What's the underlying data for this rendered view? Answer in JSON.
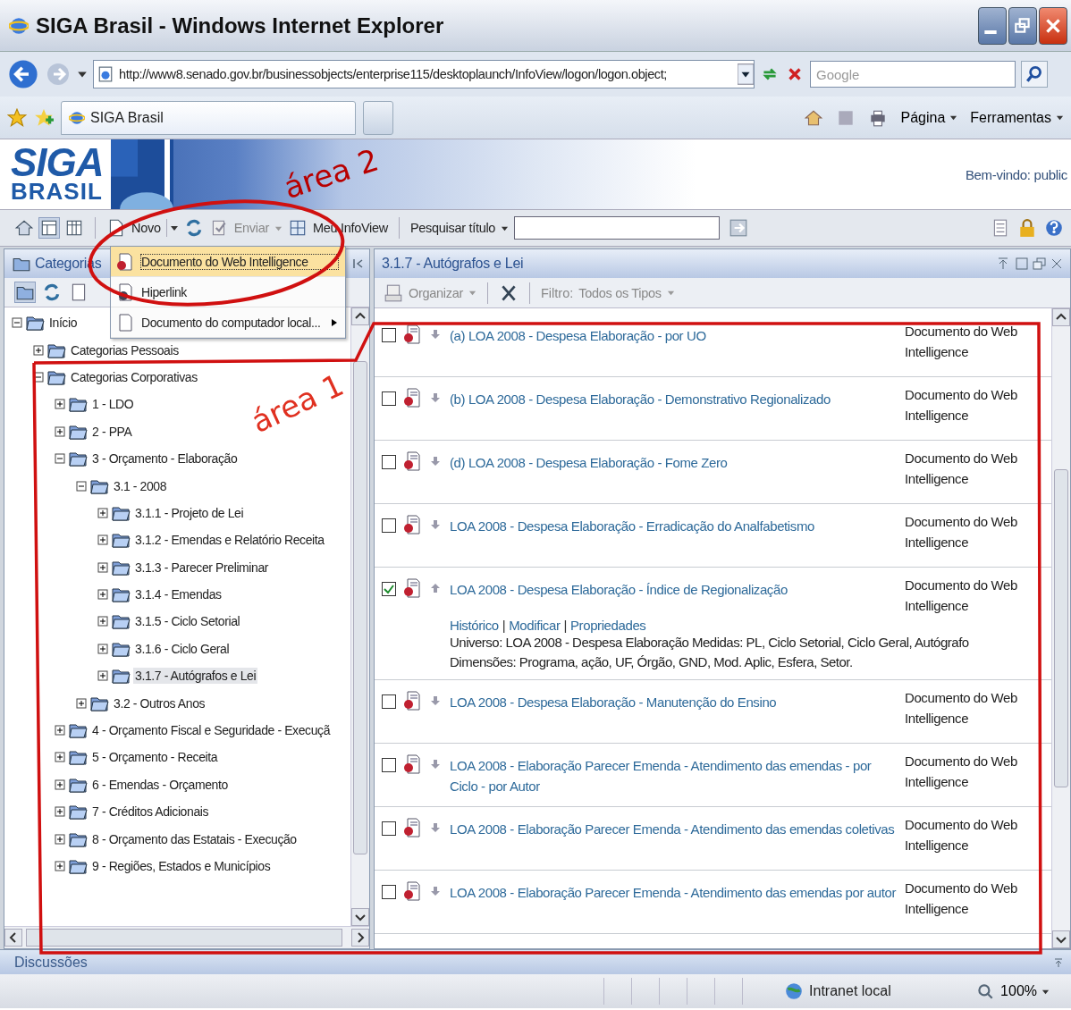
{
  "window": {
    "title": "SIGA Brasil - Windows Internet Explorer"
  },
  "address_bar": {
    "url": "http://www8.senado.gov.br/businessobjects/enterprise115/desktoplaunch/InfoView/logon/logon.object;",
    "search_placeholder": "Google"
  },
  "favorites_bar": {
    "tab": "SIGA Brasil",
    "commands": [
      "Página",
      "Ferramentas"
    ]
  },
  "banner": {
    "logo_line1": "SIGA",
    "logo_line2": "BRASIL",
    "welcome": "Bem-vindo: public"
  },
  "toolbar": {
    "new": "Novo",
    "send": "Enviar",
    "my_infoview": "Meu InfoView",
    "search_label": "Pesquisar título"
  },
  "new_menu": [
    {
      "label": "Documento do Web Intelligence",
      "selected": true,
      "submenu": false
    },
    {
      "label": "Hiperlink",
      "selected": false,
      "submenu": false
    },
    {
      "label": "Documento do computador local...",
      "selected": false,
      "submenu": true
    }
  ],
  "left_panel": {
    "title": "Categorias",
    "tree": [
      {
        "label": "Início",
        "expanded": true,
        "selected": false,
        "children": [
          {
            "label": "Categorias Pessoais",
            "expanded": false,
            "selected": false
          },
          {
            "label": "Categorias Corporativas",
            "expanded": true,
            "selected": false,
            "children": [
              {
                "label": "1 - LDO",
                "expanded": false,
                "selected": false
              },
              {
                "label": "2 - PPA",
                "expanded": false,
                "selected": false
              },
              {
                "label": "3 - Orçamento - Elaboração",
                "expanded": true,
                "selected": false,
                "children": [
                  {
                    "label": "3.1 - 2008",
                    "expanded": true,
                    "selected": false,
                    "children": [
                      {
                        "label": "3.1.1 - Projeto de Lei",
                        "expanded": false,
                        "selected": false
                      },
                      {
                        "label": "3.1.2 - Emendas e Relatório Receita",
                        "expanded": false,
                        "selected": false
                      },
                      {
                        "label": "3.1.3 - Parecer Preliminar",
                        "expanded": false,
                        "selected": false
                      },
                      {
                        "label": "3.1.4 - Emendas",
                        "expanded": false,
                        "selected": false
                      },
                      {
                        "label": "3.1.5 - Ciclo Setorial",
                        "expanded": false,
                        "selected": false
                      },
                      {
                        "label": "3.1.6 - Ciclo Geral",
                        "expanded": false,
                        "selected": false
                      },
                      {
                        "label": "3.1.7 - Autógrafos e Lei",
                        "expanded": false,
                        "selected": true
                      }
                    ]
                  },
                  {
                    "label": "3.2 - Outros Anos",
                    "expanded": false,
                    "selected": false
                  }
                ]
              },
              {
                "label": "4 - Orçamento Fiscal e Seguridade - Execuçã",
                "expanded": false,
                "selected": false
              },
              {
                "label": "5 - Orçamento - Receita",
                "expanded": false,
                "selected": false
              },
              {
                "label": "6 - Emendas - Orçamento",
                "expanded": false,
                "selected": false
              },
              {
                "label": "7 - Créditos Adicionais",
                "expanded": false,
                "selected": false
              },
              {
                "label": "8 - Orçamento das Estatais - Execução",
                "expanded": false,
                "selected": false
              },
              {
                "label": "9 - Regiões, Estados e Municípios",
                "expanded": false,
                "selected": false
              }
            ]
          }
        ]
      }
    ]
  },
  "right_panel": {
    "title": "3.1.7 - Autógrafos e Lei",
    "organize": "Organizar",
    "filter_label": "Filtro:",
    "filter_value": "Todos os Tipos",
    "rows": [
      {
        "title": "(a) LOA 2008 - Despesa Elaboração - por UO",
        "type": "Documento do Web Intelligence",
        "checked": false,
        "expanded": false
      },
      {
        "title": "(b) LOA 2008 - Despesa Elaboração - Demonstrativo Regionalizado",
        "type": "Documento do Web Intelligence",
        "checked": false,
        "expanded": false
      },
      {
        "title": "(d) LOA 2008 - Despesa Elaboração - Fome Zero",
        "type": "Documento do Web Intelligence",
        "checked": false,
        "expanded": false
      },
      {
        "title": "LOA 2008 - Despesa Elaboração - Erradicação do Analfabetismo",
        "type": "Documento do Web Intelligence",
        "checked": false,
        "expanded": false
      },
      {
        "title": "LOA 2008 - Despesa Elaboração - Índice de Regionalização",
        "type": "Documento do Web Intelligence",
        "checked": true,
        "expanded": true,
        "actions": [
          "Histórico",
          "Modificar",
          "Propriedades"
        ],
        "action_separator": "|",
        "details": [
          "Universo: LOA 2008 - Despesa Elaboração Medidas: PL, Ciclo Setorial, Ciclo Geral, Autógrafo",
          "Dimensões: Programa, ação, UF, Órgão, GND, Mod. Aplic, Esfera, Setor."
        ]
      },
      {
        "title": "LOA 2008 - Despesa Elaboração - Manutenção do Ensino",
        "type": "Documento do Web Intelligence",
        "checked": false,
        "expanded": false
      },
      {
        "title": "LOA 2008 - Elaboração Parecer Emenda - Atendimento das emendas - por Ciclo - por Autor",
        "type": "Documento do Web Intelligence",
        "checked": false,
        "expanded": false
      },
      {
        "title": "LOA 2008 - Elaboração Parecer Emenda - Atendimento das emendas coletivas",
        "type": "Documento do Web Intelligence",
        "checked": false,
        "expanded": false
      },
      {
        "title": "LOA 2008 - Elaboração Parecer Emenda - Atendimento das emendas por autor",
        "type": "Documento do Web Intelligence",
        "checked": false,
        "expanded": false
      }
    ]
  },
  "bottom_bar": {
    "title": "Discussões"
  },
  "status_bar": {
    "zone": "Intranet local",
    "zoom": "100%"
  },
  "annotations": [
    {
      "label": "área 2"
    },
    {
      "label": "área 1"
    }
  ]
}
